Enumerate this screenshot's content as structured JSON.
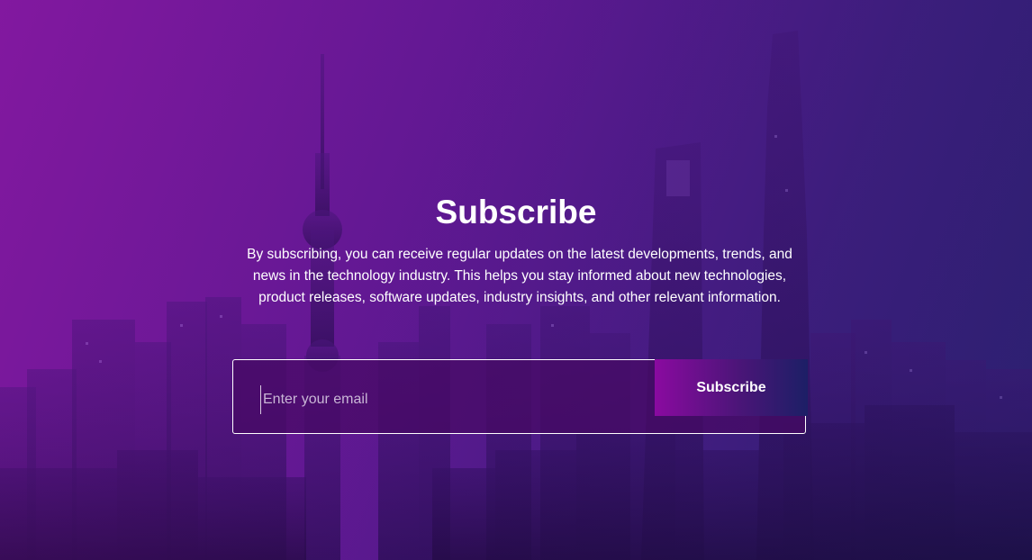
{
  "hero": {
    "title": "Subscribe",
    "description": "By subscribing, you can receive regular updates on the latest developments, trends, and news in the technology industry. This helps you stay informed about new technologies, product releases, software updates, industry insights, and other relevant information."
  },
  "form": {
    "email_placeholder": "Enter your email",
    "email_value": "",
    "button_label": "Subscribe"
  },
  "colors": {
    "background_start": "#7d1a9a",
    "background_end": "#2c2170",
    "button_gradient_start": "#8a0aa0",
    "button_gradient_end": "#1c1f66",
    "text": "#ffffff"
  },
  "icons": {
    "background_image": "city-skyline-image"
  }
}
